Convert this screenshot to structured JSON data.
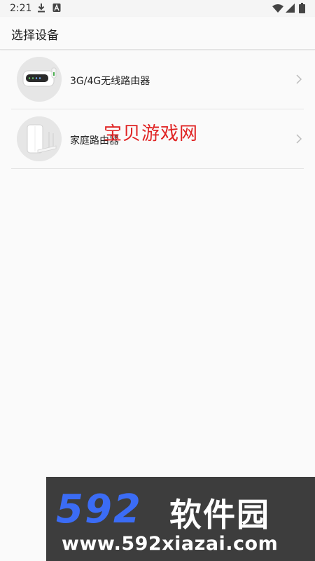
{
  "status_bar": {
    "time": "2:21",
    "icons": [
      "download-icon",
      "app-a-icon",
      "wifi-icon",
      "signal-icon",
      "battery-icon"
    ]
  },
  "app_bar": {
    "title": "选择设备"
  },
  "devices": [
    {
      "label": "3G/4G无线路由器",
      "icon": "mobile-router-icon"
    },
    {
      "label": "家庭路由器",
      "icon": "home-router-icon"
    }
  ],
  "watermark": {
    "text": "宝贝游戏网",
    "color": "#e02424"
  },
  "ad_banner": {
    "logo_number": "592",
    "logo_text": "软件园",
    "url": "www.592xiazai.com",
    "logo_number_color": "#3b6cf5"
  }
}
